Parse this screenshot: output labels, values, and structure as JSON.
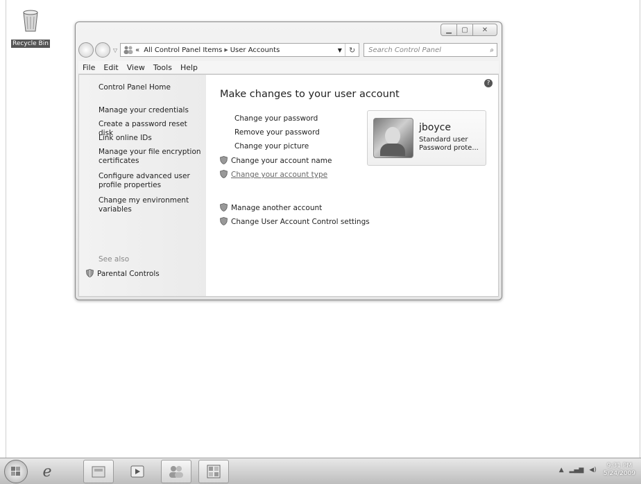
{
  "desktop": {
    "recycle_bin_label": "Recycle Bin"
  },
  "window": {
    "address": {
      "crumb1": "All Control Panel Items",
      "crumb2": "User Accounts",
      "overflow": "«"
    },
    "search_placeholder": "Search Control Panel",
    "menu": [
      "File",
      "Edit",
      "View",
      "Tools",
      "Help"
    ]
  },
  "sidebar": {
    "home": "Control Panel Home",
    "items": [
      "Manage your credentials",
      "Create a password reset disk",
      "Link online IDs",
      "Manage your file encryption certificates",
      "Configure advanced user profile properties",
      "Change my environment variables"
    ],
    "see_also": "See also",
    "parental_controls": "Parental Controls"
  },
  "main": {
    "heading": "Make changes to your user account",
    "tasks": [
      "Change your password",
      "Remove your password",
      "Change your picture",
      "Change your account name",
      "Change your account type"
    ],
    "other_tasks": [
      "Manage another account",
      "Change User Account Control settings"
    ]
  },
  "user": {
    "name": "jboyce",
    "type": "Standard user",
    "status": "Password prote..."
  },
  "taskbar": {
    "time": "9:31 PM",
    "date": "5/24/2009"
  }
}
